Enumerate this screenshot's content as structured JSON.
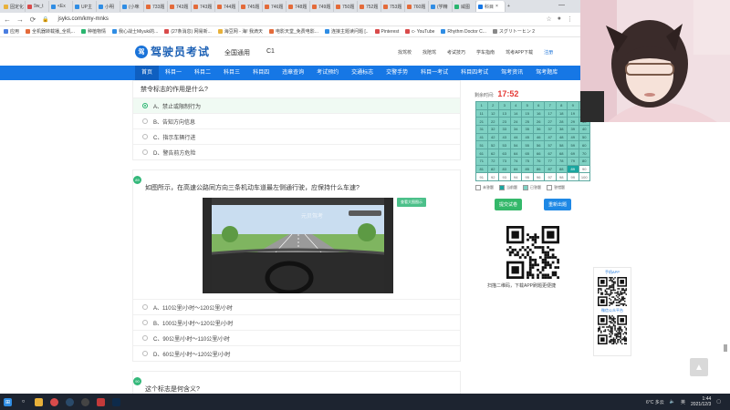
{
  "browser": {
    "tabs": [
      {
        "label": "固定化",
        "color": "#e8b13a"
      },
      {
        "label": "9w_t",
        "color": "#d94b4b"
      },
      {
        "label": "<Ex",
        "color": "#2f8de4"
      },
      {
        "label": "UP主",
        "color": "#2f8de4"
      },
      {
        "label": "小明",
        "color": "#2f8de4"
      },
      {
        "label": "(小咪",
        "color": "#2f8de4"
      },
      {
        "label": "733题",
        "color": "#e46b3a"
      },
      {
        "label": "743题",
        "color": "#e46b3a"
      },
      {
        "label": "743题",
        "color": "#e46b3a"
      },
      {
        "label": "744题",
        "color": "#e46b3a"
      },
      {
        "label": "745题",
        "color": "#e46b3a"
      },
      {
        "label": "746题",
        "color": "#e46b3a"
      },
      {
        "label": "748题",
        "color": "#e46b3a"
      },
      {
        "label": "749题",
        "color": "#e46b3a"
      },
      {
        "label": "750题",
        "color": "#e46b3a"
      },
      {
        "label": "752题",
        "color": "#e46b3a"
      },
      {
        "label": "753题",
        "color": "#e46b3a"
      },
      {
        "label": "760题",
        "color": "#e46b3a"
      },
      {
        "label": "(学精",
        "color": "#2f8de4"
      },
      {
        "label": "威图",
        "color": "#2ab56f"
      },
      {
        "label": "科目",
        "color": "#1677e5"
      }
    ],
    "active_tab_index": 20,
    "close_glyph": "×",
    "new_tab_glyph": "+",
    "minimize_glyph": "—",
    "url": "jsyks.com/kmy-mnks",
    "bookmarks": [
      {
        "label": "应用",
        "color": "#4a7de0"
      },
      {
        "label": "全机器转载播_全机...",
        "color": "#e46b3a"
      },
      {
        "label": "种植物情",
        "color": "#2ab56f"
      },
      {
        "label": "我心战士Miyuki的...",
        "color": "#2f8de4"
      },
      {
        "label": "(27条消息) 网易新...",
        "color": "#d94b4b"
      },
      {
        "label": "海豆网 - 海! 我滴天",
        "color": "#e8b13a"
      },
      {
        "label": "电影天堂_免费电影...",
        "color": "#e46b3a"
      },
      {
        "label": "连接主题读问题 [..",
        "color": "#2f8de4"
      },
      {
        "label": "Pinterest",
        "color": "#d94b4b"
      },
      {
        "label": "c- YouTube",
        "color": "#d94b4b"
      },
      {
        "label": "Rhythm Doctor C...",
        "color": "#2f8de4"
      },
      {
        "label": "スグリトーヒン 2",
        "color": "#888888"
      }
    ]
  },
  "site": {
    "logo_mark": "驾",
    "logo_text": "驾驶员考试",
    "region": "全国通用",
    "license": "C1",
    "header_links": [
      "找驾校",
      "找陪驾",
      "考试技巧",
      "学车指南",
      "驾考APP下载"
    ],
    "login": "注册",
    "nav": [
      "首页",
      "科目一",
      "科目二",
      "科目三",
      "科目四",
      "违章查询",
      "考试预约",
      "交通标志",
      "交警手势",
      "科目一考试",
      "科目四考试",
      "驾考资讯",
      "驾考题库"
    ]
  },
  "questions": {
    "q1": {
      "title": "禁令标志的作用是什么?",
      "options": [
        "A、禁止或限制行为",
        "B、告知方向信息",
        "C、指示车辆行进",
        "D、警告前方危险"
      ],
      "selected": 0
    },
    "q2": {
      "num": "89",
      "title": "如图所示，在高速公路同方向三条机动车道最左侧通行驶，应保持什么车速?",
      "figure_button": "查看大图图示",
      "figure_watermark": "元贝驾考",
      "options": [
        "A、110公里/小时～120公里/小时",
        "B、100公里/小时～120公里/小时",
        "C、90公里/小时～110公里/小时",
        "D、60公里/小时～120公里/小时"
      ]
    },
    "q3": {
      "num": "90",
      "title": "这个标志是何含义?"
    }
  },
  "sidebar": {
    "timer_label": "剩余时间:",
    "timer_value": "17:52",
    "current_question": 89,
    "numbers_answered_upto": 88,
    "legend": [
      "未答题",
      "当前题",
      "已答题",
      "答错题"
    ],
    "submit": "提交试卷",
    "restart": "重新出题",
    "qr_caption": "扫描二维码，下载APP刷题更便捷",
    "widget_app_label": "手机APP",
    "widget_wechat_label": "微信公众平台"
  },
  "taskbar": {
    "weather": "6°C 多云",
    "time": "1:44",
    "date": "2021/12/3",
    "ime": "英"
  }
}
